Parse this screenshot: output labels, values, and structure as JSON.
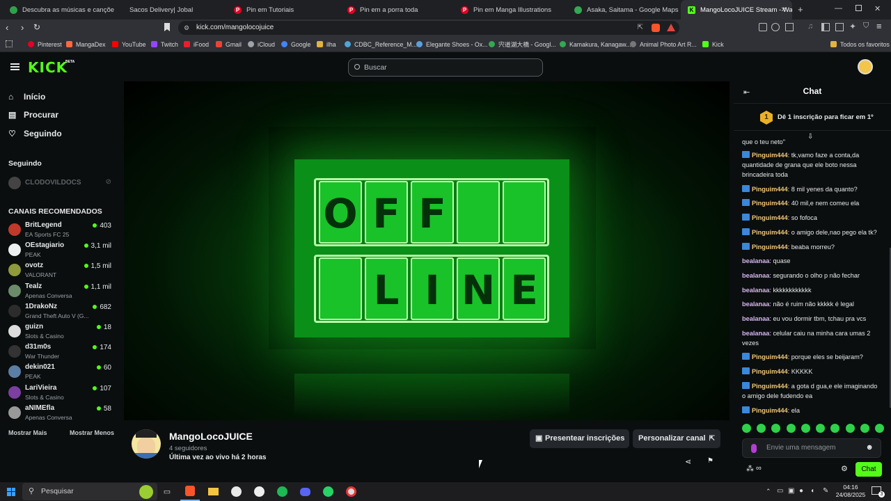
{
  "browser": {
    "tabs": [
      {
        "label": "Descubra as músicas e canções mai",
        "color": "#2fa14d"
      },
      {
        "label": "Sacos Delivery| Jobal",
        "color": ""
      },
      {
        "label": "Pin em Tutoriais",
        "color": "#e60023"
      },
      {
        "label": "Pin em a porra toda",
        "color": "#e60023"
      },
      {
        "label": "Pin em Manga Illustrations",
        "color": "#e60023"
      },
      {
        "label": "Asaka, Saitama - Google Maps",
        "color": "#34a853"
      },
      {
        "label": "MangoLocoJUICE Stream - Watc",
        "color": "#53fc18"
      }
    ],
    "url": "kick.com/mangolocojuice",
    "bookmarks": [
      {
        "label": "Pinterest",
        "color": "#e60023"
      },
      {
        "label": "MangaDex",
        "color": "#ff6740"
      },
      {
        "label": "YouTube",
        "color": "#ff0000"
      },
      {
        "label": "Twitch",
        "color": "#9146ff"
      },
      {
        "label": "iFood",
        "color": "#ea1d2c"
      },
      {
        "label": "Gmail",
        "color": "#ea4335"
      },
      {
        "label": "iCloud",
        "color": "#9ea4aa"
      },
      {
        "label": "Google",
        "color": "#4285f4"
      },
      {
        "label": "ilha",
        "color": "#e3b341"
      },
      {
        "label": "CDBC_Reference_M...",
        "color": "#4fa3d9"
      },
      {
        "label": "Elegante Shoes - Ox...",
        "color": "#5aa0e0"
      },
      {
        "label": "宍道湖大橋 - Googl...",
        "color": "#34a853"
      },
      {
        "label": "Kamakura, Kanagaw...",
        "color": "#34a853"
      },
      {
        "label": "Animal Photo Art R...",
        "color": "#777777"
      },
      {
        "label": "Kick",
        "color": "#53fc18"
      }
    ],
    "bookmarks_folder": "Todos os favoritos"
  },
  "kick": {
    "logo": "KICK",
    "beta": "BETA",
    "search_placeholder": "Buscar",
    "nav": [
      {
        "label": "Início",
        "icon": "home-icon"
      },
      {
        "label": "Procurar",
        "icon": "browse-icon"
      },
      {
        "label": "Seguindo",
        "icon": "heart-icon"
      }
    ],
    "following_title": "Seguindo",
    "following": [
      {
        "name": "CLODOVILDOCS"
      }
    ],
    "recommended_title": "CANAIS RECOMENDADOS",
    "recommended": [
      {
        "name": "BritLegend",
        "game": "EA Sports FC 25",
        "viewers": "403",
        "color": "#c0392b"
      },
      {
        "name": "OEstagiario",
        "game": "PEAK",
        "viewers": "3,1 mil",
        "color": "#ecf0f1"
      },
      {
        "name": "ovotz",
        "game": "VALORANT",
        "viewers": "1,5 mil",
        "color": "#8e9a3b"
      },
      {
        "name": "Tealz",
        "game": "Apenas Conversa",
        "viewers": "1,1 mil",
        "color": "#6c8b6a"
      },
      {
        "name": "1DrakoNz",
        "game": "Grand Theft Auto V (G...",
        "viewers": "682",
        "color": "#2c2c2c"
      },
      {
        "name": "guizn",
        "game": "Slots & Casino",
        "viewers": "18",
        "color": "#dddddd"
      },
      {
        "name": "d31m0s",
        "game": "War Thunder",
        "viewers": "174",
        "color": "#333333"
      },
      {
        "name": "dekin021",
        "game": "PEAK",
        "viewers": "60",
        "color": "#5b7ea6"
      },
      {
        "name": "LariVieira",
        "game": "Slots & Casino",
        "viewers": "107",
        "color": "#7b3fa0"
      },
      {
        "name": "aNIMEfla",
        "game": "Apenas Conversa",
        "viewers": "58",
        "color": "#999999"
      }
    ],
    "show_more": "Mostrar Mais",
    "show_less": "Mostrar Menos",
    "offline_letters_top": [
      "O",
      "F",
      "F",
      "",
      ""
    ],
    "offline_letters_bottom": [
      "",
      "L",
      "I",
      "N",
      "E"
    ],
    "channel": {
      "name": "MangoLocoJUICE",
      "followers": "4 seguidores",
      "last_live": "Última vez ao vivo há 2 horas",
      "gift_button": "Presentear inscrições",
      "customize_button": "Personalizar canal"
    },
    "chat": {
      "title": "Chat",
      "rank_text": "Dê 1 inscrição para ficar em 1º",
      "rank_number": "1",
      "partial_top": "que o teu neto\"",
      "messages": [
        {
          "user": "Pinguim444",
          "text": "tk,vamo faze a conta,da quantidade de grana que ele boto nessa brincadeira toda",
          "badge": true
        },
        {
          "user": "Pinguim444",
          "text": "8 mil yenes da quanto?",
          "badge": true
        },
        {
          "user": "Pinguim444",
          "text": "40 mil,e nem comeu ela",
          "badge": true
        },
        {
          "user": "Pinguim444",
          "text": "so fofoca",
          "badge": true
        },
        {
          "user": "Pinguim444",
          "text": "o amigo dele,nao pego ela tk?",
          "badge": true
        },
        {
          "user": "Pinguim444",
          "text": "beaba morreu?",
          "badge": true
        },
        {
          "user": "bealanaa",
          "text": "quase",
          "badge": false
        },
        {
          "user": "bealanaa",
          "text": "segurando o olho p não fechar",
          "badge": false
        },
        {
          "user": "bealanaa",
          "text": "kkkkkkkkkkkk",
          "badge": false
        },
        {
          "user": "bealanaa",
          "text": "não é ruim não kkkkk é legal",
          "badge": false
        },
        {
          "user": "bealanaa",
          "text": "eu vou dormir tbm, tchau pra vcs",
          "badge": false
        },
        {
          "user": "bealanaa",
          "text": "celular caiu na minha cara umas 2 vezes",
          "badge": false
        },
        {
          "user": "Pinguim444",
          "text": "porque eles se beijaram?",
          "badge": true
        },
        {
          "user": "Pinguim444",
          "text": "KKKKK",
          "badge": true
        },
        {
          "user": "Pinguim444",
          "text": "a gota d gua,e ele imaginando o amigo dele fudendo ea",
          "badge": true
        },
        {
          "user": "Pinguim444",
          "text": "ela",
          "badge": true
        }
      ],
      "input_placeholder": "Envie uma mensagem",
      "send_button": "Chat",
      "points": "∞"
    }
  },
  "taskbar": {
    "search_placeholder": "Pesquisar",
    "time": "04:16",
    "date": "24/08/2025",
    "notifications": "3"
  }
}
